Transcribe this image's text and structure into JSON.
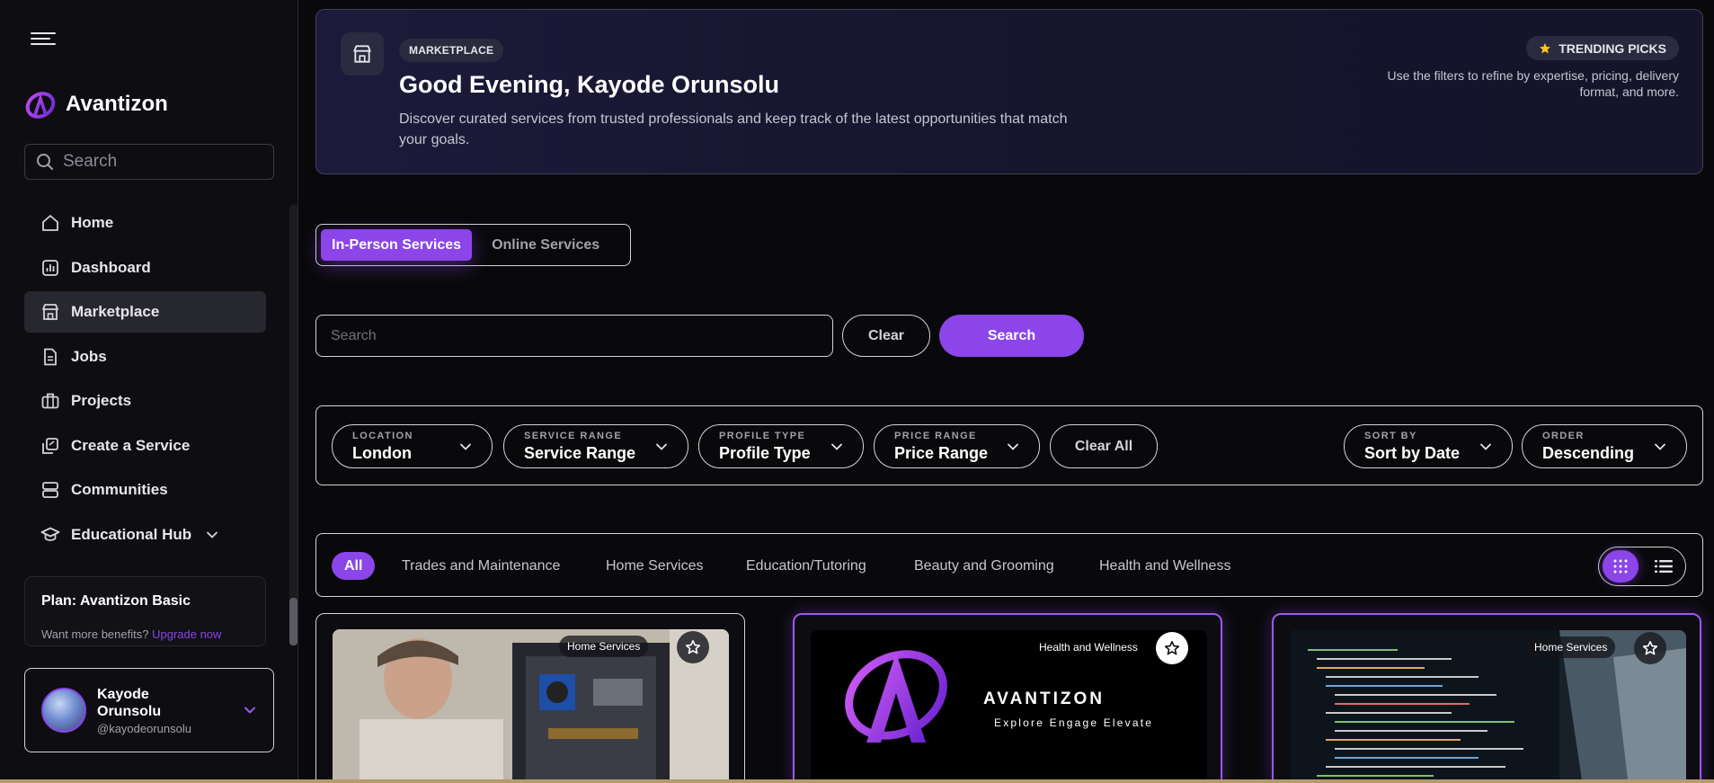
{
  "sidebar": {
    "brand": "Avantizon",
    "search_placeholder": "Search",
    "items": [
      {
        "label": "Home",
        "icon": "home-icon"
      },
      {
        "label": "Dashboard",
        "icon": "dashboard-icon"
      },
      {
        "label": "Marketplace",
        "icon": "store-icon",
        "active": true
      },
      {
        "label": "Jobs",
        "icon": "document-icon"
      },
      {
        "label": "Projects",
        "icon": "briefcase-icon"
      },
      {
        "label": "Create a Service",
        "icon": "create-icon"
      },
      {
        "label": "Communities",
        "icon": "communities-icon"
      },
      {
        "label": "Educational Hub",
        "icon": "graduation-cap-icon"
      }
    ],
    "plan": {
      "title": "Plan: Avantizon Basic",
      "subtitle": "Want more benefits?",
      "upgrade_link": "Upgrade now"
    },
    "user": {
      "name": "Kayode Orunsolu",
      "handle": "@kayodeorunsolu"
    }
  },
  "hero": {
    "badge": "MARKETPLACE",
    "title": "Good Evening, Kayode Orunsolu",
    "description": "Discover curated services from trusted professionals and keep track of the latest opportunities that match your goals.",
    "trending": "TRENDING PICKS",
    "note": "Use the filters to refine by expertise, pricing, delivery format, and more."
  },
  "service_tabs": [
    {
      "label": "In-Person Services",
      "active": true
    },
    {
      "label": "Online Services",
      "active": false
    }
  ],
  "search": {
    "placeholder": "Search",
    "clear_label": "Clear",
    "search_label": "Search"
  },
  "filters": [
    {
      "label": "LOCATION",
      "value": "London"
    },
    {
      "label": "SERVICE RANGE",
      "value": "Service Range"
    },
    {
      "label": "PROFILE TYPE",
      "value": "Profile Type"
    },
    {
      "label": "PRICE RANGE",
      "value": "Price Range"
    }
  ],
  "clear_all_label": "Clear All",
  "sort": [
    {
      "label": "SORT BY",
      "value": "Sort by Date"
    },
    {
      "label": "ORDER",
      "value": "Descending"
    }
  ],
  "categories": [
    {
      "label": "All",
      "active": true
    },
    {
      "label": "Trades and Maintenance"
    },
    {
      "label": "Home Services"
    },
    {
      "label": "Education/Tutoring"
    },
    {
      "label": "Beauty and Grooming"
    },
    {
      "label": "Health and Wellness"
    }
  ],
  "cards": [
    {
      "tag": "Home Services"
    },
    {
      "tag": "Health and Wellness",
      "logo_word": "AVANTIZON",
      "logo_tagline": "Explore Engage Elevate"
    },
    {
      "tag": "Home Services"
    }
  ],
  "colors": {
    "accent": "#8b45e8",
    "background": "#09090b"
  }
}
